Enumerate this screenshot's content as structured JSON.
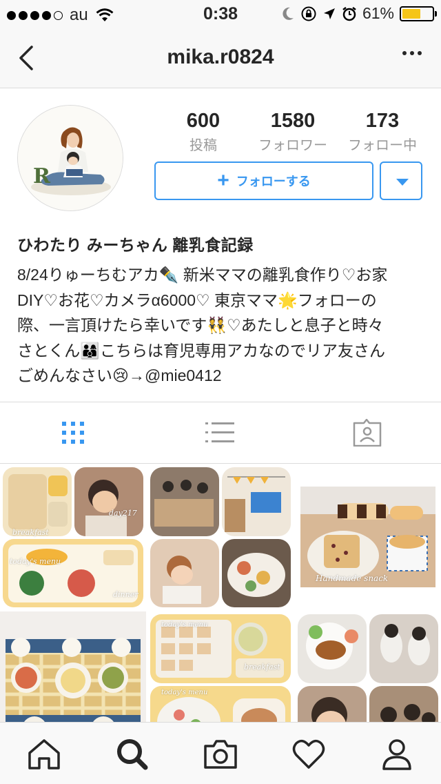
{
  "status_bar": {
    "carrier": "au",
    "time": "0:38",
    "battery": "61%",
    "battery_level": 0.61
  },
  "nav": {
    "title": "mika.r0824",
    "back_icon": "chevron-left-icon",
    "more_icon": "more-horizontal-icon"
  },
  "profile": {
    "stats": [
      {
        "value": "600",
        "label": "投稿"
      },
      {
        "value": "1580",
        "label": "フォロワー"
      },
      {
        "value": "173",
        "label": "フォロー中"
      }
    ],
    "follow_label": "フォローする",
    "display_name": "ひわたり みーちゃん 離乳食記録",
    "bio_lines": [
      "8/24りゅーちむアカ✒️ 新米ママの離乳食作り♡お家",
      "DIY♡お花♡カメラα6000♡ 東京ママ🌟フォローの",
      "際、一言頂けたら幸いです👯♡あたしと息子と時々",
      "さとくん👨‍👩‍👦こちらは育児専用アカなのでリア友さん",
      "ごめんなさい😢→@mie0412"
    ]
  },
  "tabs": [
    {
      "name": "grid-view",
      "icon": "grid-icon",
      "active": true
    },
    {
      "name": "list-view",
      "icon": "list-icon",
      "active": false
    },
    {
      "name": "tagged",
      "icon": "tagged-person-icon",
      "active": false
    }
  ],
  "grid_posts": [
    {
      "captions": [
        "breakfast",
        "day217",
        "today's menu",
        "dinner"
      ]
    },
    {
      "captions": []
    },
    {
      "captions": [
        "Handmade snack"
      ]
    },
    {
      "captions": []
    },
    {
      "captions": [
        "today's menu",
        "breakfast",
        "today's menu"
      ]
    },
    {
      "captions": []
    }
  ],
  "bottom_nav": [
    {
      "name": "home",
      "icon": "home-icon"
    },
    {
      "name": "search",
      "icon": "search-icon",
      "active": true
    },
    {
      "name": "camera",
      "icon": "camera-icon"
    },
    {
      "name": "activity",
      "icon": "heart-icon"
    },
    {
      "name": "profile",
      "icon": "person-icon"
    }
  ],
  "colors": {
    "accent": "#3897f0",
    "text": "#262626",
    "muted": "#999999",
    "battery": "#f5c518"
  }
}
